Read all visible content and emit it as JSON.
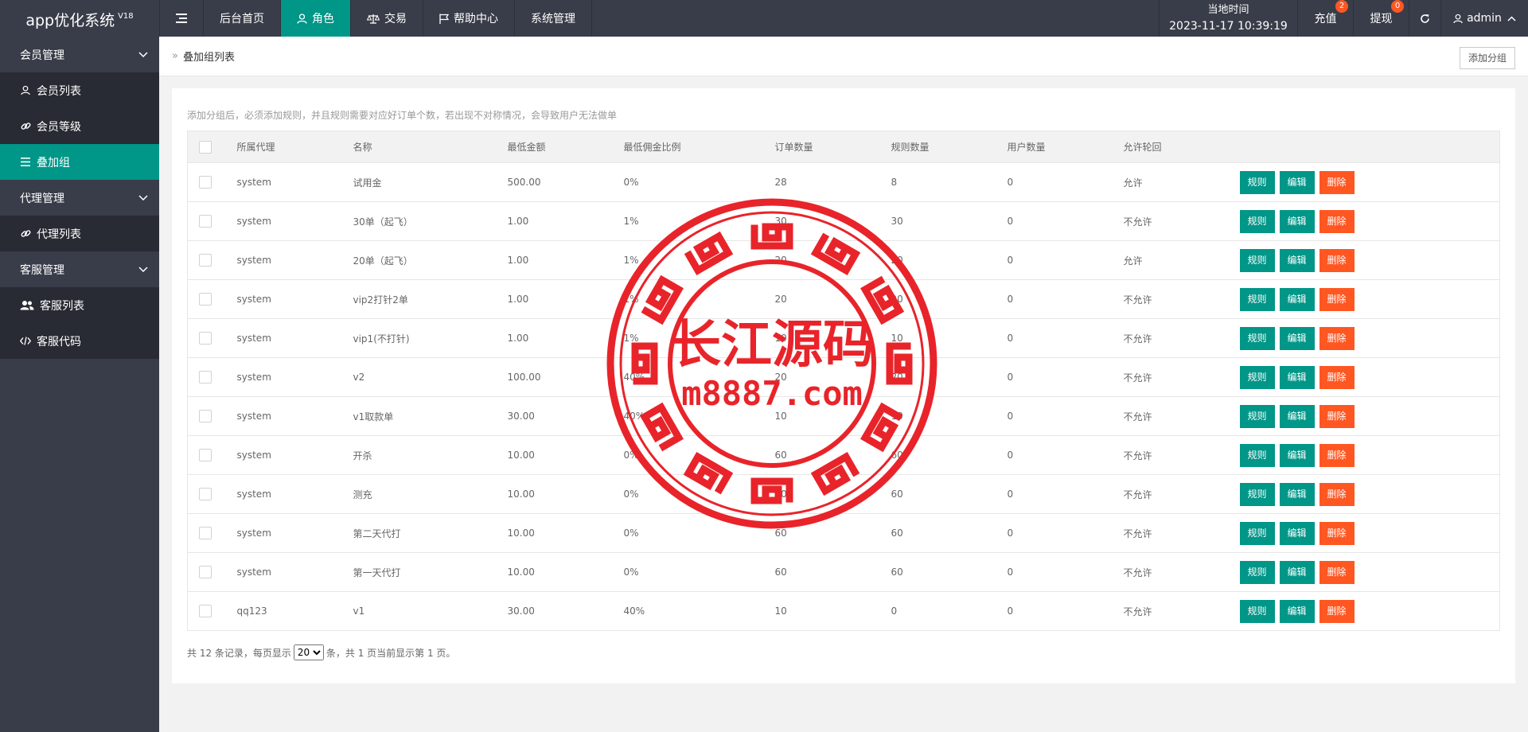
{
  "app": {
    "title": "app优化系统",
    "version": "V18"
  },
  "nav": [
    {
      "label": "后台首页",
      "icon": ""
    },
    {
      "label": "角色",
      "icon": "user-icon",
      "active": true
    },
    {
      "label": "交易",
      "icon": "balance-icon"
    },
    {
      "label": "帮助中心",
      "icon": "flag-icon"
    },
    {
      "label": "系统管理",
      "icon": ""
    }
  ],
  "header": {
    "time_label": "当地时间",
    "time_value": "2023-11-17 10:39:19",
    "recharge_label": "充值",
    "recharge_badge": "2",
    "withdraw_label": "提现",
    "withdraw_badge": "0",
    "user_name": "admin"
  },
  "sidebar": {
    "groups": [
      {
        "label": "会员管理",
        "items": [
          {
            "label": "会员列表",
            "icon": "user-icon"
          },
          {
            "label": "会员等级",
            "icon": "link-icon"
          },
          {
            "label": "叠加组",
            "icon": "list-icon",
            "active": true
          }
        ]
      },
      {
        "label": "代理管理",
        "items": [
          {
            "label": "代理列表",
            "icon": "link-icon"
          }
        ]
      },
      {
        "label": "客服管理",
        "items": [
          {
            "label": "客服列表",
            "icon": "users-icon"
          },
          {
            "label": "客服代码",
            "icon": "code-icon"
          }
        ]
      }
    ]
  },
  "breadcrumb": {
    "sep": "»",
    "current": "叠加组列表"
  },
  "add_button": "添加分组",
  "notice": "添加分组后，必须添加规则，并且规则需要对应好订单个数，若出现不对称情况，会导致用户无法做单",
  "table": {
    "columns": [
      "所属代理",
      "名称",
      "最低金额",
      "最低佣金比例",
      "订单数量",
      "规则数量",
      "用户数量",
      "允许轮回"
    ],
    "rows": [
      [
        "system",
        "试用金",
        "500.00",
        "0%",
        "28",
        "8",
        "0",
        "允许"
      ],
      [
        "system",
        "30单（起飞）",
        "1.00",
        "1%",
        "30",
        "30",
        "0",
        "不允许"
      ],
      [
        "system",
        "20单（起飞）",
        "1.00",
        "1%",
        "20",
        "20",
        "0",
        "允许"
      ],
      [
        "system",
        "vip2打针2单",
        "1.00",
        "1%",
        "20",
        "20",
        "0",
        "不允许"
      ],
      [
        "system",
        "vip1(不打针)",
        "1.00",
        "1%",
        "10",
        "10",
        "0",
        "不允许"
      ],
      [
        "system",
        "v2",
        "100.00",
        "40%",
        "20",
        "20",
        "0",
        "不允许"
      ],
      [
        "system",
        "v1取款单",
        "30.00",
        "40%",
        "10",
        "10",
        "0",
        "不允许"
      ],
      [
        "system",
        "开杀",
        "10.00",
        "0%",
        "60",
        "60",
        "0",
        "不允许"
      ],
      [
        "system",
        "测充",
        "10.00",
        "0%",
        "60",
        "60",
        "0",
        "不允许"
      ],
      [
        "system",
        "第二天代打",
        "10.00",
        "0%",
        "60",
        "60",
        "0",
        "不允许"
      ],
      [
        "system",
        "第一天代打",
        "10.00",
        "0%",
        "60",
        "60",
        "0",
        "不允许"
      ],
      [
        "qq123",
        "v1",
        "30.00",
        "40%",
        "10",
        "0",
        "0",
        "不允许"
      ]
    ],
    "actions": [
      "规则",
      "编辑",
      "删除"
    ]
  },
  "pager": {
    "prefix": "共 12 条记录，每页显示",
    "page_size": "20",
    "suffix": "条，共 1 页当前显示第 1 页。"
  },
  "watermark": {
    "line1": "长江源码",
    "line2": "m8887.com",
    "color": "#e8242a"
  },
  "colors": {
    "header_bg": "#393d49",
    "accent": "#009688",
    "danger": "#ff5722",
    "sidebar_sub_bg": "#282b33"
  }
}
